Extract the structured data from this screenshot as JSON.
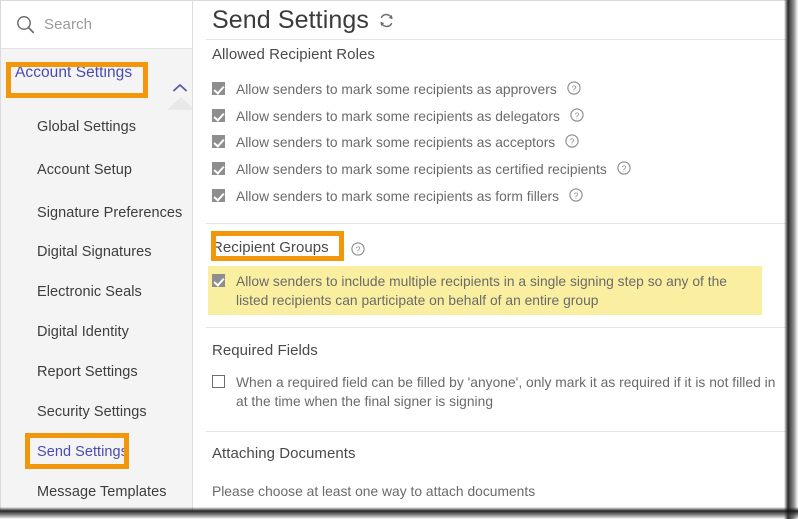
{
  "theme": {
    "accent_highlight": "#F2960B",
    "link_color": "#4a4bb0",
    "yellow_highlight": "#FAEFA0",
    "sidebar_bg": "#f4f4f4",
    "checkbox_fill": "#8e8e8e"
  },
  "sidebar": {
    "search": {
      "placeholder": "Search",
      "icon": "search-icon"
    },
    "group": {
      "label": "Account Settings",
      "chevron_icon": "chevron-up-icon",
      "expanded": true,
      "highlighted": true
    },
    "items": [
      {
        "label": "Global Settings",
        "active": false
      },
      {
        "label": "Account Setup",
        "active": false
      },
      {
        "label": "Signature Preferences",
        "active": false
      },
      {
        "label": "Digital Signatures",
        "active": false
      },
      {
        "label": "Electronic Seals",
        "active": false
      },
      {
        "label": "Digital Identity",
        "active": false
      },
      {
        "label": "Report Settings",
        "active": false
      },
      {
        "label": "Security Settings",
        "active": false
      },
      {
        "label": "Send Settings",
        "active": true
      },
      {
        "label": "Message Templates",
        "active": false
      }
    ]
  },
  "main": {
    "title": "Send Settings",
    "refresh_icon": "refresh-icon",
    "sections": [
      {
        "heading": "Allowed Recipient Roles",
        "options": [
          {
            "label": "Allow senders to mark some recipients as approvers",
            "checked": true,
            "help": true
          },
          {
            "label": "Allow senders to mark some recipients as delegators",
            "checked": true,
            "help": true
          },
          {
            "label": "Allow senders to mark some recipients as acceptors",
            "checked": true,
            "help": true
          },
          {
            "label": "Allow senders to mark some recipients as certified recipients",
            "checked": true,
            "help": true
          },
          {
            "label": "Allow senders to mark some recipients as form fillers",
            "checked": true,
            "help": true
          }
        ]
      },
      {
        "heading": "Recipient Groups",
        "heading_help": true,
        "heading_highlighted": true,
        "options": [
          {
            "label": "Allow senders to include multiple recipients in a single signing step so any of the listed recipients can participate on behalf of an entire group",
            "checked": true,
            "help": false,
            "highlighted": true
          }
        ]
      },
      {
        "heading": "Required Fields",
        "options": [
          {
            "label": "When a required field can be filled by 'anyone', only mark it as required if it is not filled in at the time when the final signer is signing",
            "checked": false,
            "help": false
          }
        ]
      },
      {
        "heading": "Attaching Documents",
        "description": "Please choose at least one way to attach documents"
      }
    ]
  }
}
